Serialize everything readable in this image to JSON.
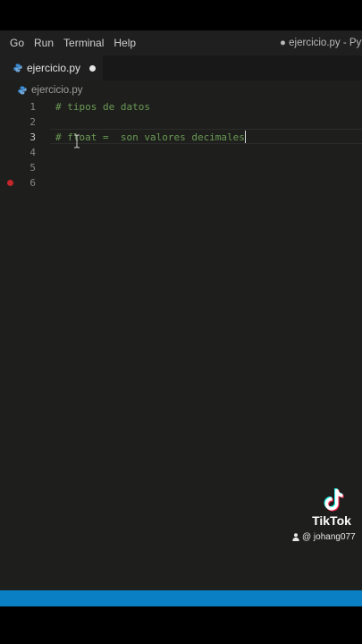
{
  "menubar": {
    "items": [
      "Go",
      "Run",
      "Terminal",
      "Help"
    ],
    "window_title": "● ejercicio.py - Pyth"
  },
  "tab": {
    "label": "ejercicio.py",
    "unsaved": true
  },
  "breadcrumb": {
    "file": "ejercicio.py"
  },
  "editor": {
    "lines": [
      {
        "number": "1",
        "text": "# tipos de datos"
      },
      {
        "number": "2",
        "text": ""
      },
      {
        "number": "3",
        "text": "# float =  son valores decimales"
      },
      {
        "number": "4",
        "text": ""
      },
      {
        "number": "5",
        "text": ""
      },
      {
        "number": "6",
        "text": ""
      }
    ],
    "active_line": 3,
    "breakpoint_line": 6
  },
  "watermark": {
    "brand": "TikTok",
    "user": "@ johang077"
  },
  "colors": {
    "comment": "#6a9955",
    "statusbar": "#0b7fc4",
    "breakpoint": "#c4262b",
    "python_icon": "#3b8ed6"
  },
  "icons": [
    "python-file-icon",
    "unsaved-dot-icon",
    "breakpoint-icon",
    "tiktok-logo-icon",
    "user-icon",
    "text-cursor-icon"
  ]
}
